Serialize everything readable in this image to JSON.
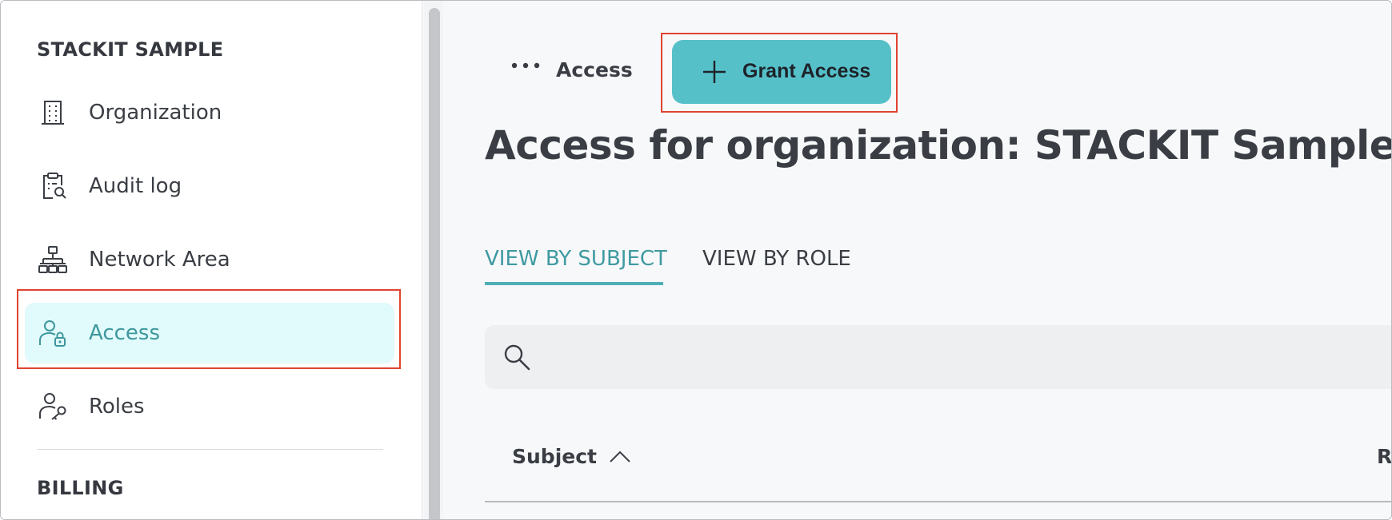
{
  "sidebar": {
    "org_section_title": "STACKIT SAMPLE",
    "items": [
      {
        "label": "Organization",
        "icon": "building-icon"
      },
      {
        "label": "Audit log",
        "icon": "clipboard-search-icon"
      },
      {
        "label": "Network Area",
        "icon": "network-icon"
      },
      {
        "label": "Access",
        "icon": "user-lock-icon",
        "active": true
      },
      {
        "label": "Roles",
        "icon": "user-key-icon"
      }
    ],
    "billing_section_title": "BILLING"
  },
  "header": {
    "breadcrumb_label": "Access",
    "grant_button_label": "Grant Access"
  },
  "main": {
    "page_title": "Access for organization: STACKIT Sample",
    "tabs": [
      {
        "label": "VIEW BY SUBJECT",
        "active": true
      },
      {
        "label": "VIEW BY ROLE",
        "active": false
      }
    ],
    "search": {
      "value": ""
    },
    "table": {
      "columns": [
        "Subject",
        "R"
      ]
    }
  },
  "colors": {
    "accent": "#56c0c9",
    "active_tab": "#3f9aa2",
    "active_nav_bg": "#e1fafb",
    "highlight_box": "#e0432f"
  }
}
